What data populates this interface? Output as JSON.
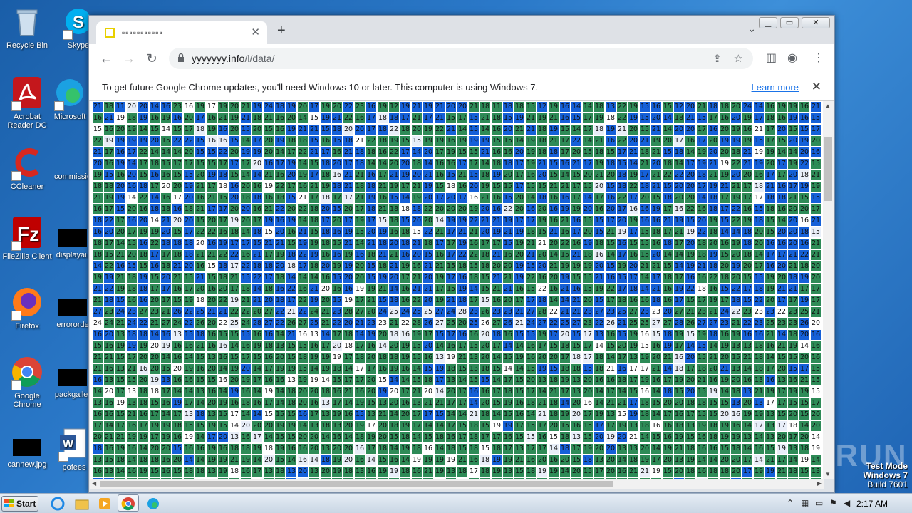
{
  "desktop": {
    "icons": [
      {
        "label": "Recycle Bin",
        "icon": "recycle-bin-icon"
      },
      {
        "label": "Skype",
        "icon": "skype-icon"
      },
      {
        "label": "Acrobat Reader DC",
        "icon": "acrobat-icon"
      },
      {
        "label": "Microsoft",
        "icon": "edge-icon"
      },
      {
        "label": "CCleaner",
        "icon": "ccleaner-icon"
      },
      {
        "label": "commissio",
        "icon": "document-icon"
      },
      {
        "label": "FileZilla Client",
        "icon": "filezilla-icon"
      },
      {
        "label": "displayau",
        "icon": "file-icon"
      },
      {
        "label": "Firefox",
        "icon": "firefox-icon"
      },
      {
        "label": "errororde",
        "icon": "file-icon"
      },
      {
        "label": "Google Chrome",
        "icon": "chrome-icon"
      },
      {
        "label": "packgaller",
        "icon": "file-icon"
      },
      {
        "label": "cannew.jpg",
        "icon": "image-icon"
      },
      {
        "label": "pofees",
        "icon": "word-icon"
      }
    ],
    "watermark": "ANY RUN",
    "test_mode": {
      "line1": "Test Mode",
      "line2": "Windows 7",
      "line3": "Build 7601"
    }
  },
  "browser": {
    "tab_title": "▫▫▫▫▫▫▫▫▫▫▫",
    "url_host": "yyyyyyy.info",
    "url_path": "/l/data/",
    "infobar_message": "To get future Google Chrome updates, you'll need Windows 10 or later. This computer is using Windows 7.",
    "infobar_link": "Learn more",
    "colors": {
      "green": "#2e8b57",
      "dark_green": "#3a7d44",
      "blue": "#1560d8",
      "light": "#e8eef8",
      "white": "#ffffff"
    }
  },
  "grid": {
    "cols": 64,
    "rows": 34,
    "first_row_values": [
      21,
      18,
      11,
      20,
      20,
      14,
      16,
      23,
      16,
      19,
      17,
      19,
      20,
      21,
      19,
      24,
      18,
      19,
      20,
      17,
      19,
      20,
      22,
      23,
      16,
      19,
      12,
      19,
      21,
      19,
      21,
      20,
      20,
      21,
      18,
      11,
      18,
      18,
      15,
      12,
      19,
      16,
      14,
      14,
      18,
      13,
      22,
      19,
      15,
      16,
      15,
      12,
      20,
      21,
      18,
      18,
      20,
      24,
      14,
      16,
      19,
      19,
      16,
      21
    ]
  },
  "taskbar": {
    "start_label": "Start",
    "clock": "2:17 AM"
  }
}
